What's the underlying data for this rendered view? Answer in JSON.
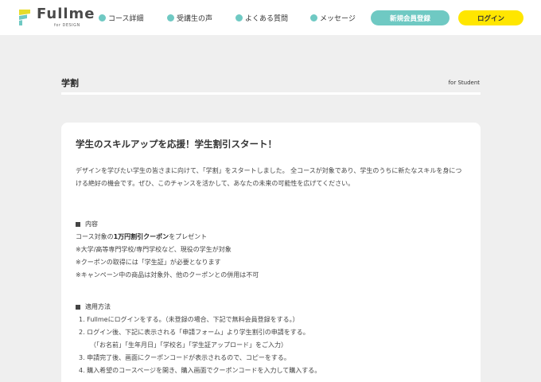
{
  "header": {
    "logo_text": "Fullme",
    "logo_sub": "for DESIGN",
    "nav": [
      {
        "label": "コース詳細"
      },
      {
        "label": "受講生の声"
      },
      {
        "label": "よくある質問"
      },
      {
        "label": "メッセージ"
      }
    ],
    "register_label": "新規会員登録",
    "login_label": "ログイン"
  },
  "colors": {
    "accent": "#6fc9c3",
    "login": "#ffe600",
    "background": "#efefef"
  },
  "page": {
    "title": "学割",
    "subtitle": "for Student"
  },
  "card": {
    "heading": "学生のスキルアップを応援！学生割引スタート！",
    "intro": "デザインを学びたい学生の皆さまに向けて、「学割」をスタートしました。 全コースが対象であり、学生のうちに新たなスキルを身につける絶好の機会です。ぜひ、このチャンスを活かして、あなたの未来の可能性を広げてください。",
    "contents": {
      "title": "内容",
      "line1_pre": "コース対象の",
      "line1_bold": "1万円割引クーポン",
      "line1_post": "をプレゼント",
      "notes": [
        "※大学/高等専門学校/専門学校など、現役の学生が対象",
        "※クーポンの取得には「学生証」が必要となります",
        "※キャンペーン中の商品は対象外、他のクーポンとの併用は不可"
      ]
    },
    "method": {
      "title": "適用方法",
      "steps": [
        "1. Fullmeにログインをする。（未登録の場合、下記で無料会員登録をする。）",
        "2. ログイン後、下記に表示される「申請フォーム」より学生割引の申請をする。",
        "（「お名前」「生年月日」「学校名」「学生証アップロード」をご入力）",
        "3. 申請完了後、画面にクーポンコードが表示されるので、コピーをする。",
        "4. 購入希望のコースページを開き、購入画面でクーポンコードを入力して購入する。"
      ]
    }
  }
}
